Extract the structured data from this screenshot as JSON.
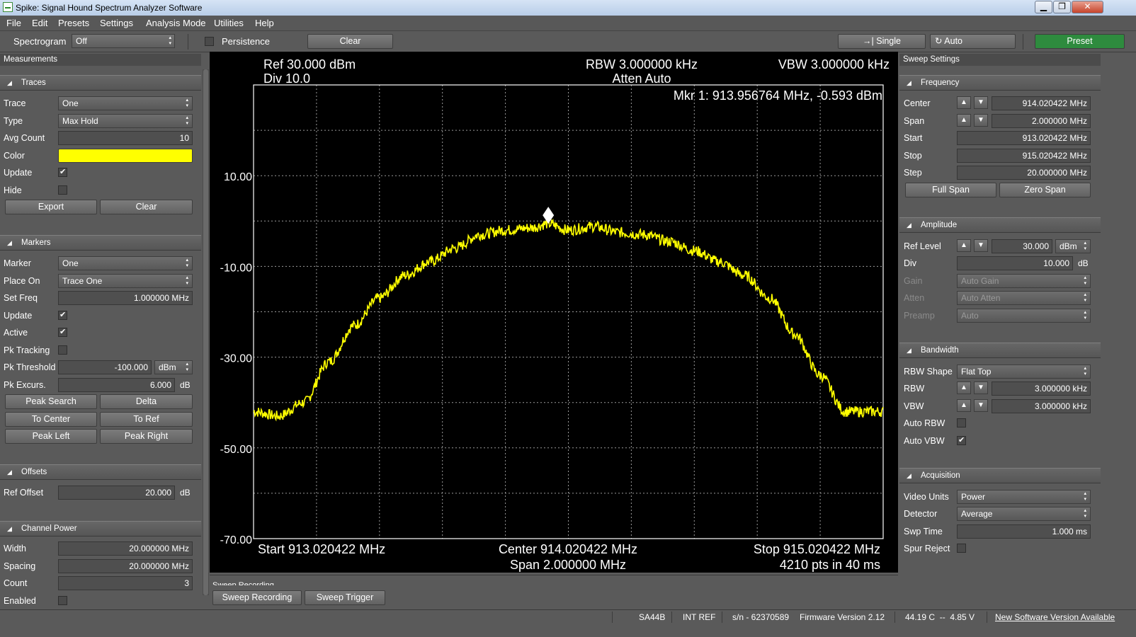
{
  "window": {
    "title": "Spike: Signal Hound Spectrum Analyzer Software",
    "minimize": "▁",
    "maximize": "❐",
    "close": "✕"
  },
  "menu": [
    "File",
    "Edit",
    "Presets",
    "Settings",
    "Analysis Mode",
    "Utilities",
    "Help"
  ],
  "toolbar": {
    "spectrogram_label": "Spectrogram",
    "spectrogram_value": "Off",
    "persistence_label": "Persistence",
    "clear_label": "Clear",
    "single_label": "Single",
    "auto_label": "Auto",
    "preset_label": "Preset",
    "preset_color": "#2e8b3e"
  },
  "left": {
    "header": "Measurements",
    "traces": {
      "title": "Traces",
      "trace_label": "Trace",
      "trace_value": "One",
      "type_label": "Type",
      "type_value": "Max Hold",
      "avg_label": "Avg Count",
      "avg_value": "10",
      "color_label": "Color",
      "color_value": "#ffff00",
      "update_label": "Update",
      "update_checked": true,
      "hide_label": "Hide",
      "hide_checked": false,
      "export_label": "Export",
      "clear_label": "Clear"
    },
    "markers": {
      "title": "Markers",
      "marker_label": "Marker",
      "marker_value": "One",
      "placeon_label": "Place On",
      "placeon_value": "Trace One",
      "setfreq_label": "Set Freq",
      "setfreq_value": "1.000000 MHz",
      "update_label": "Update",
      "update_checked": true,
      "active_label": "Active",
      "active_checked": true,
      "pktrack_label": "Pk Tracking",
      "pktrack_checked": false,
      "pkthresh_label": "Pk Threshold",
      "pkthresh_value": "-100.000",
      "pkthresh_unit": "dBm",
      "pkexcurs_label": "Pk Excurs.",
      "pkexcurs_value": "6.000",
      "pkexcurs_unit": "dB",
      "peaksearch_label": "Peak Search",
      "delta_label": "Delta",
      "tocenter_label": "To Center",
      "toref_label": "To Ref",
      "peakleft_label": "Peak Left",
      "peakright_label": "Peak Right"
    },
    "offsets": {
      "title": "Offsets",
      "refoffset_label": "Ref Offset",
      "refoffset_value": "20.000",
      "refoffset_unit": "dB"
    },
    "channel_power": {
      "title": "Channel Power",
      "width_label": "Width",
      "width_value": "20.000000 MHz",
      "spacing_label": "Spacing",
      "spacing_value": "20.000000 MHz",
      "count_label": "Count",
      "count_value": "3",
      "enabled_label": "Enabled",
      "enabled_checked": false
    }
  },
  "right": {
    "header": "Sweep Settings",
    "frequency": {
      "title": "Frequency",
      "center_label": "Center",
      "center_value": "914.020422 MHz",
      "span_label": "Span",
      "span_value": "2.000000 MHz",
      "start_label": "Start",
      "start_value": "913.020422 MHz",
      "stop_label": "Stop",
      "stop_value": "915.020422 MHz",
      "step_label": "Step",
      "step_value": "20.000000 MHz",
      "fullspan_label": "Full Span",
      "zerospan_label": "Zero Span"
    },
    "amplitude": {
      "title": "Amplitude",
      "reflevel_label": "Ref Level",
      "reflevel_value": "30.000",
      "reflevel_unit": "dBm",
      "div_label": "Div",
      "div_value": "10.000",
      "div_unit": "dB",
      "gain_label": "Gain",
      "gain_value": "Auto Gain",
      "atten_label": "Atten",
      "atten_value": "Auto Atten",
      "preamp_label": "Preamp",
      "preamp_value": "Auto"
    },
    "bandwidth": {
      "title": "Bandwidth",
      "rbwshape_label": "RBW Shape",
      "rbwshape_value": "Flat Top",
      "rbw_label": "RBW",
      "rbw_value": "3.000000 kHz",
      "vbw_label": "VBW",
      "vbw_value": "3.000000 kHz",
      "autorbw_label": "Auto RBW",
      "autorbw_checked": false,
      "autovbw_label": "Auto VBW",
      "autovbw_checked": true
    },
    "acquisition": {
      "title": "Acquisition",
      "videounits_label": "Video Units",
      "videounits_value": "Power",
      "detector_label": "Detector",
      "detector_value": "Average",
      "swptime_label": "Swp Time",
      "swptime_value": "1.000 ms",
      "spurreject_label": "Spur Reject",
      "spurreject_checked": false
    }
  },
  "plot": {
    "ref": "Ref 30.000 dBm",
    "div": "Div 10.0",
    "rbw": "RBW 3.000000 kHz",
    "atten": "Atten Auto",
    "vbw": "VBW 3.000000 kHz",
    "marker_readout": "Mkr 1: 913.956764 MHz, -0.593 dBm",
    "start": "Start 913.020422 MHz",
    "center": "Center 914.020422 MHz",
    "span": "Span 2.000000 MHz",
    "stop": "Stop 915.020422 MHz",
    "pts": "4210 pts in 40 ms",
    "ytick_labels": [
      "10.00",
      "-10.00",
      "-30.00",
      "-50.00",
      "-70.00"
    ]
  },
  "chart_data": {
    "type": "line",
    "x_unit": "MHz",
    "y_unit": "dBm",
    "xlim": [
      913.020422,
      915.020422
    ],
    "ylim": [
      -70,
      30
    ],
    "y_div": 10,
    "grid": true,
    "trace_color": "#ffff00",
    "series": [
      {
        "x": [
          913.020422,
          913.1,
          913.18,
          913.26,
          913.34,
          913.42,
          913.5,
          913.58,
          913.66,
          913.74,
          913.82,
          913.9,
          913.956764,
          914.02,
          914.1,
          914.18,
          914.26,
          914.34,
          914.42,
          914.5,
          914.58,
          914.66,
          914.74,
          914.82,
          914.9,
          914.94,
          915.020422
        ],
        "y": [
          -42,
          -43,
          -40,
          -31,
          -23,
          -17,
          -12,
          -9,
          -6,
          -3,
          -2,
          -1.5,
          -0.593,
          -2,
          -1.2,
          -2.5,
          -3,
          -4.5,
          -6.5,
          -9,
          -12,
          -17,
          -25,
          -34,
          -42,
          -42,
          -42
        ]
      }
    ],
    "marker": {
      "x": 913.956764,
      "y": -0.593,
      "label": "Mkr 1"
    }
  },
  "bottom": {
    "sweep_recording_tab": "Sweep Recording",
    "sweep_recording_btn": "Sweep Recording",
    "sweep_trigger_btn": "Sweep Trigger"
  },
  "status": {
    "device": "SA44B",
    "ref": "INT REF",
    "serial": "s/n - 62370589",
    "firmware": "Firmware Version 2.12",
    "temp": "44.19 C  --  4.85 V",
    "update": "New Software Version Available"
  }
}
